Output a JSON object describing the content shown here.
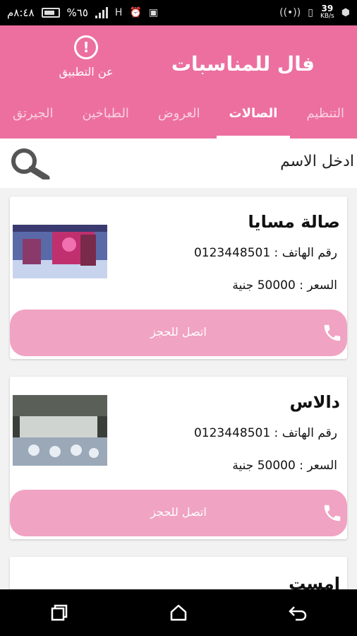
{
  "statusbar": {
    "time": "٨:٤٨م",
    "battery": "%٦٥",
    "network": "H",
    "speed": "39",
    "speed_unit": "KB/s"
  },
  "appbar": {
    "title": "فال للمناسبات",
    "about_label": "عن التطبيق",
    "about_icon_glyph": "!"
  },
  "tabs": [
    {
      "label": "التنظيم",
      "active": false
    },
    {
      "label": "الصالات",
      "active": true
    },
    {
      "label": "العروض",
      "active": false
    },
    {
      "label": "الطباخين",
      "active": false
    },
    {
      "label": "الجيرتق",
      "active": false
    }
  ],
  "search": {
    "placeholder": "ادخل الاسم"
  },
  "cards": [
    {
      "name": "صالة مسايا",
      "phone": "رقم الهاتف : 0123448501",
      "price": "السعر : 50000 جنية",
      "call_label": "اتصل للحجز"
    },
    {
      "name": "دالاس",
      "phone": "رقم الهاتف : 0123448501",
      "price": "السعر : 50000 جنية",
      "call_label": "اتصل للحجز"
    }
  ],
  "partial_card": {
    "name": "امست"
  },
  "colors": {
    "primary": "#ec6fa0",
    "button": "#f0a3c2"
  }
}
